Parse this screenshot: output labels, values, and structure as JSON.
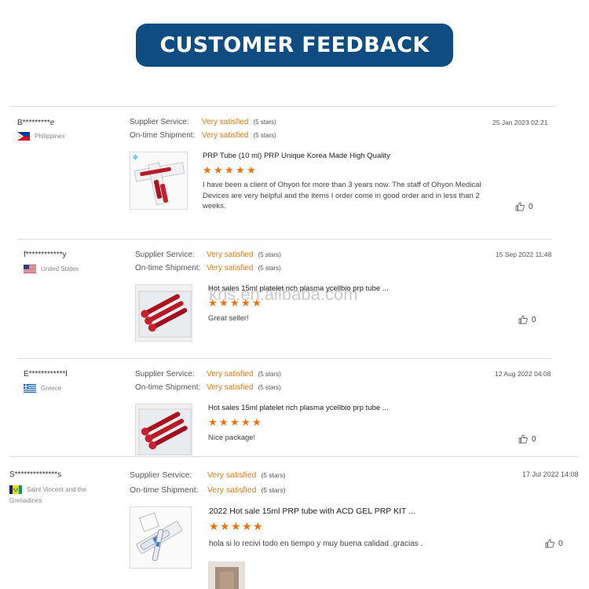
{
  "header": {
    "title": "CUSTOMER FEEDBACK"
  },
  "watermark": "krls.en.alibaba.com",
  "labels": {
    "supplier_service": "Supplier Service:",
    "ontime_shipment": "On-time Shipment:"
  },
  "reviews": [
    {
      "buyer": "B*********e",
      "country": "Philippines",
      "flag": "philippines",
      "supplier_service": "Very satisfied",
      "supplier_stars": "(5 stars)",
      "ontime_shipment": "Very satisfied",
      "ontime_stars": "(5 stars)",
      "date": "25 Jan 2023 02:21",
      "product": "PRP Tube (10 ml) PRP Unique Korea Made High Quality",
      "rating": 5,
      "comment": "I have been a client of Ohyon for more than 3 years now. The staff of Ohyon Medical Devices are very helpful and the items I order come in good order and in less than 2 weeks.",
      "likes": "0"
    },
    {
      "buyer": "f************y",
      "country": "United States",
      "flag": "us",
      "supplier_service": "Very satisfied",
      "supplier_stars": "(5 stars)",
      "ontime_shipment": "Very satisfied",
      "ontime_stars": "(5 stars)",
      "date": "15 Sep 2022 11:48",
      "product": "Hot sales 15ml platelet rich plasma ycellbio prp tube ...",
      "rating": 5,
      "comment": "Great seller!",
      "likes": "0"
    },
    {
      "buyer": "E************l",
      "country": "Greece",
      "flag": "greece",
      "supplier_service": "Very satisfied",
      "supplier_stars": "(5 stars)",
      "ontime_shipment": "Very satisfied",
      "ontime_stars": "(5 stars)",
      "date": "12 Aug 2022 04:08",
      "product": "Hot sales 15ml platelet rich plasma ycellbio prp tube ...",
      "rating": 5,
      "comment": "Nice package!",
      "likes": "0"
    },
    {
      "buyer": "S**************s",
      "country": "Saint Vincent and the Grenadines",
      "flag": "svg",
      "supplier_service": "Very satisfied",
      "supplier_stars": "(5 stars)",
      "ontime_shipment": "Very satisfied",
      "ontime_stars": "(5 stars)",
      "date": "17 Jul 2022 14:08",
      "product": "2022 Hot sale 15ml PRP tube with ACD GEL PRP KIT ...",
      "rating": 5,
      "comment": "hola si lo recivi todo en tiempo y muy buena calidad .gracias .",
      "likes": "0"
    }
  ],
  "colors": {
    "banner": "#0f4c81",
    "accent": "#e8780e",
    "star": "#f07010"
  }
}
